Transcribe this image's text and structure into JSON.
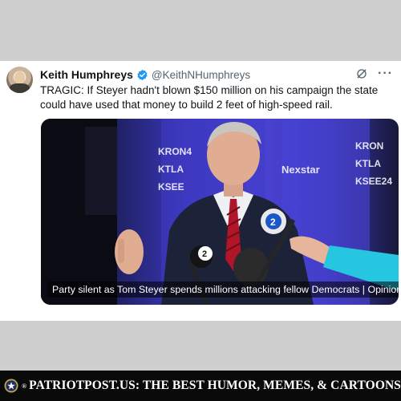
{
  "tweet": {
    "author_name": "Keith Humphreys",
    "author_handle": "@KeithNHumphreys",
    "text": "TRAGIC: If Steyer hadn't blown $150 million on his campaign the state could have used that money to build 2 feet of high-speed rail.",
    "media_caption": "Party silent as Tom Steyer spends millions attacking fellow Democrats | Opinion",
    "more_label": "···",
    "icons": [
      "verified-badge-icon",
      "grok-icon",
      "more-icon"
    ]
  },
  "background_signage": [
    "KRON4",
    "KTLA",
    "KSEE",
    "Nexstar",
    "KRON",
    "KTLA",
    "KSEE24"
  ],
  "mic_logos": [
    "2",
    "2"
  ],
  "footer": {
    "registered_mark": "®",
    "text": "PATRIOTPOST.US: THE BEST HUMOR, MEMES, & CARTOONS"
  },
  "colors": {
    "accent": "#1d9bf0",
    "text": "#0f1419",
    "muted": "#536471",
    "page_bg": "#cfcfcf",
    "footer_bg": "#0a0a0a"
  }
}
